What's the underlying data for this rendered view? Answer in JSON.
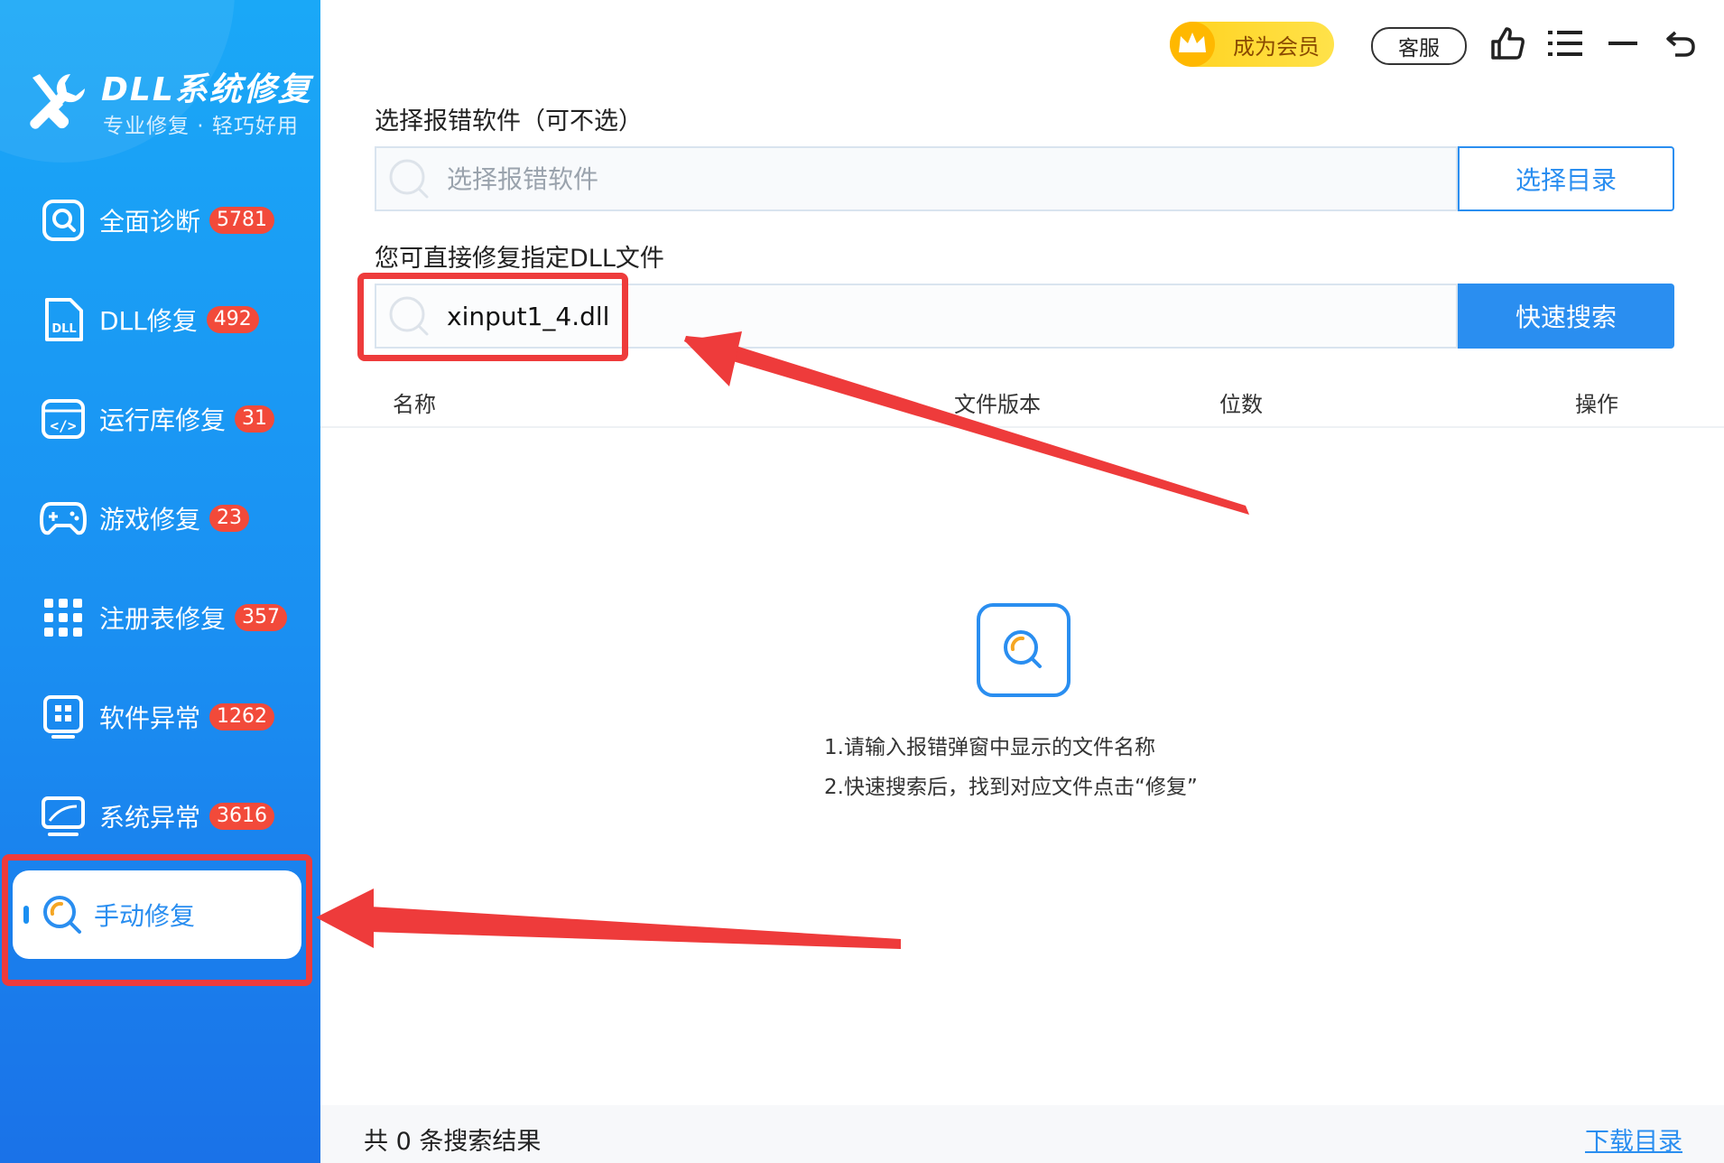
{
  "app": {
    "title": "DLL系统修复",
    "subtitle": "专业修复 · 轻巧好用"
  },
  "topbar": {
    "vip_label": "成为会员",
    "service_label": "客服",
    "icons": [
      "thumbs-up-icon",
      "menu-list-icon",
      "minimize-icon",
      "back-icon"
    ]
  },
  "sidebar": {
    "items": [
      {
        "label": "全面诊断",
        "badge": "5781",
        "icon": "search-square-icon"
      },
      {
        "label": "DLL修复",
        "badge": "492",
        "icon": "dll-file-icon"
      },
      {
        "label": "运行库修复",
        "badge": "31",
        "icon": "code-window-icon"
      },
      {
        "label": "游戏修复",
        "badge": "23",
        "icon": "gamepad-icon"
      },
      {
        "label": "注册表修复",
        "badge": "357",
        "icon": "grid-icon"
      },
      {
        "label": "软件异常",
        "badge": "1262",
        "icon": "app-window-icon"
      },
      {
        "label": "系统异常",
        "badge": "3616",
        "icon": "monitor-chart-icon"
      }
    ],
    "active": {
      "label": "手动修复",
      "icon": "manual-search-icon"
    }
  },
  "software_section": {
    "label": "选择报错软件（可不选）",
    "placeholder": "选择报错软件",
    "button": "选择目录"
  },
  "dll_section": {
    "label": "您可直接修复指定DLL文件",
    "value": "xinput1_4.dll",
    "button": "快速搜索"
  },
  "table": {
    "columns": [
      "名称",
      "文件版本",
      "位数",
      "操作"
    ]
  },
  "empty_state": {
    "hint1": "1.请输入报错弹窗中显示的文件名称",
    "hint2": "2.快速搜索后，找到对应文件点击“修复”"
  },
  "footer": {
    "count_text": "共 0 条搜索结果",
    "download_link": "下载目录"
  },
  "colors": {
    "accent": "#2a8ef0",
    "sidebar_top": "#1aa8f7",
    "sidebar_bottom": "#1a72e8",
    "badge": "#f24a3a",
    "annotation": "#ee3b3b"
  }
}
